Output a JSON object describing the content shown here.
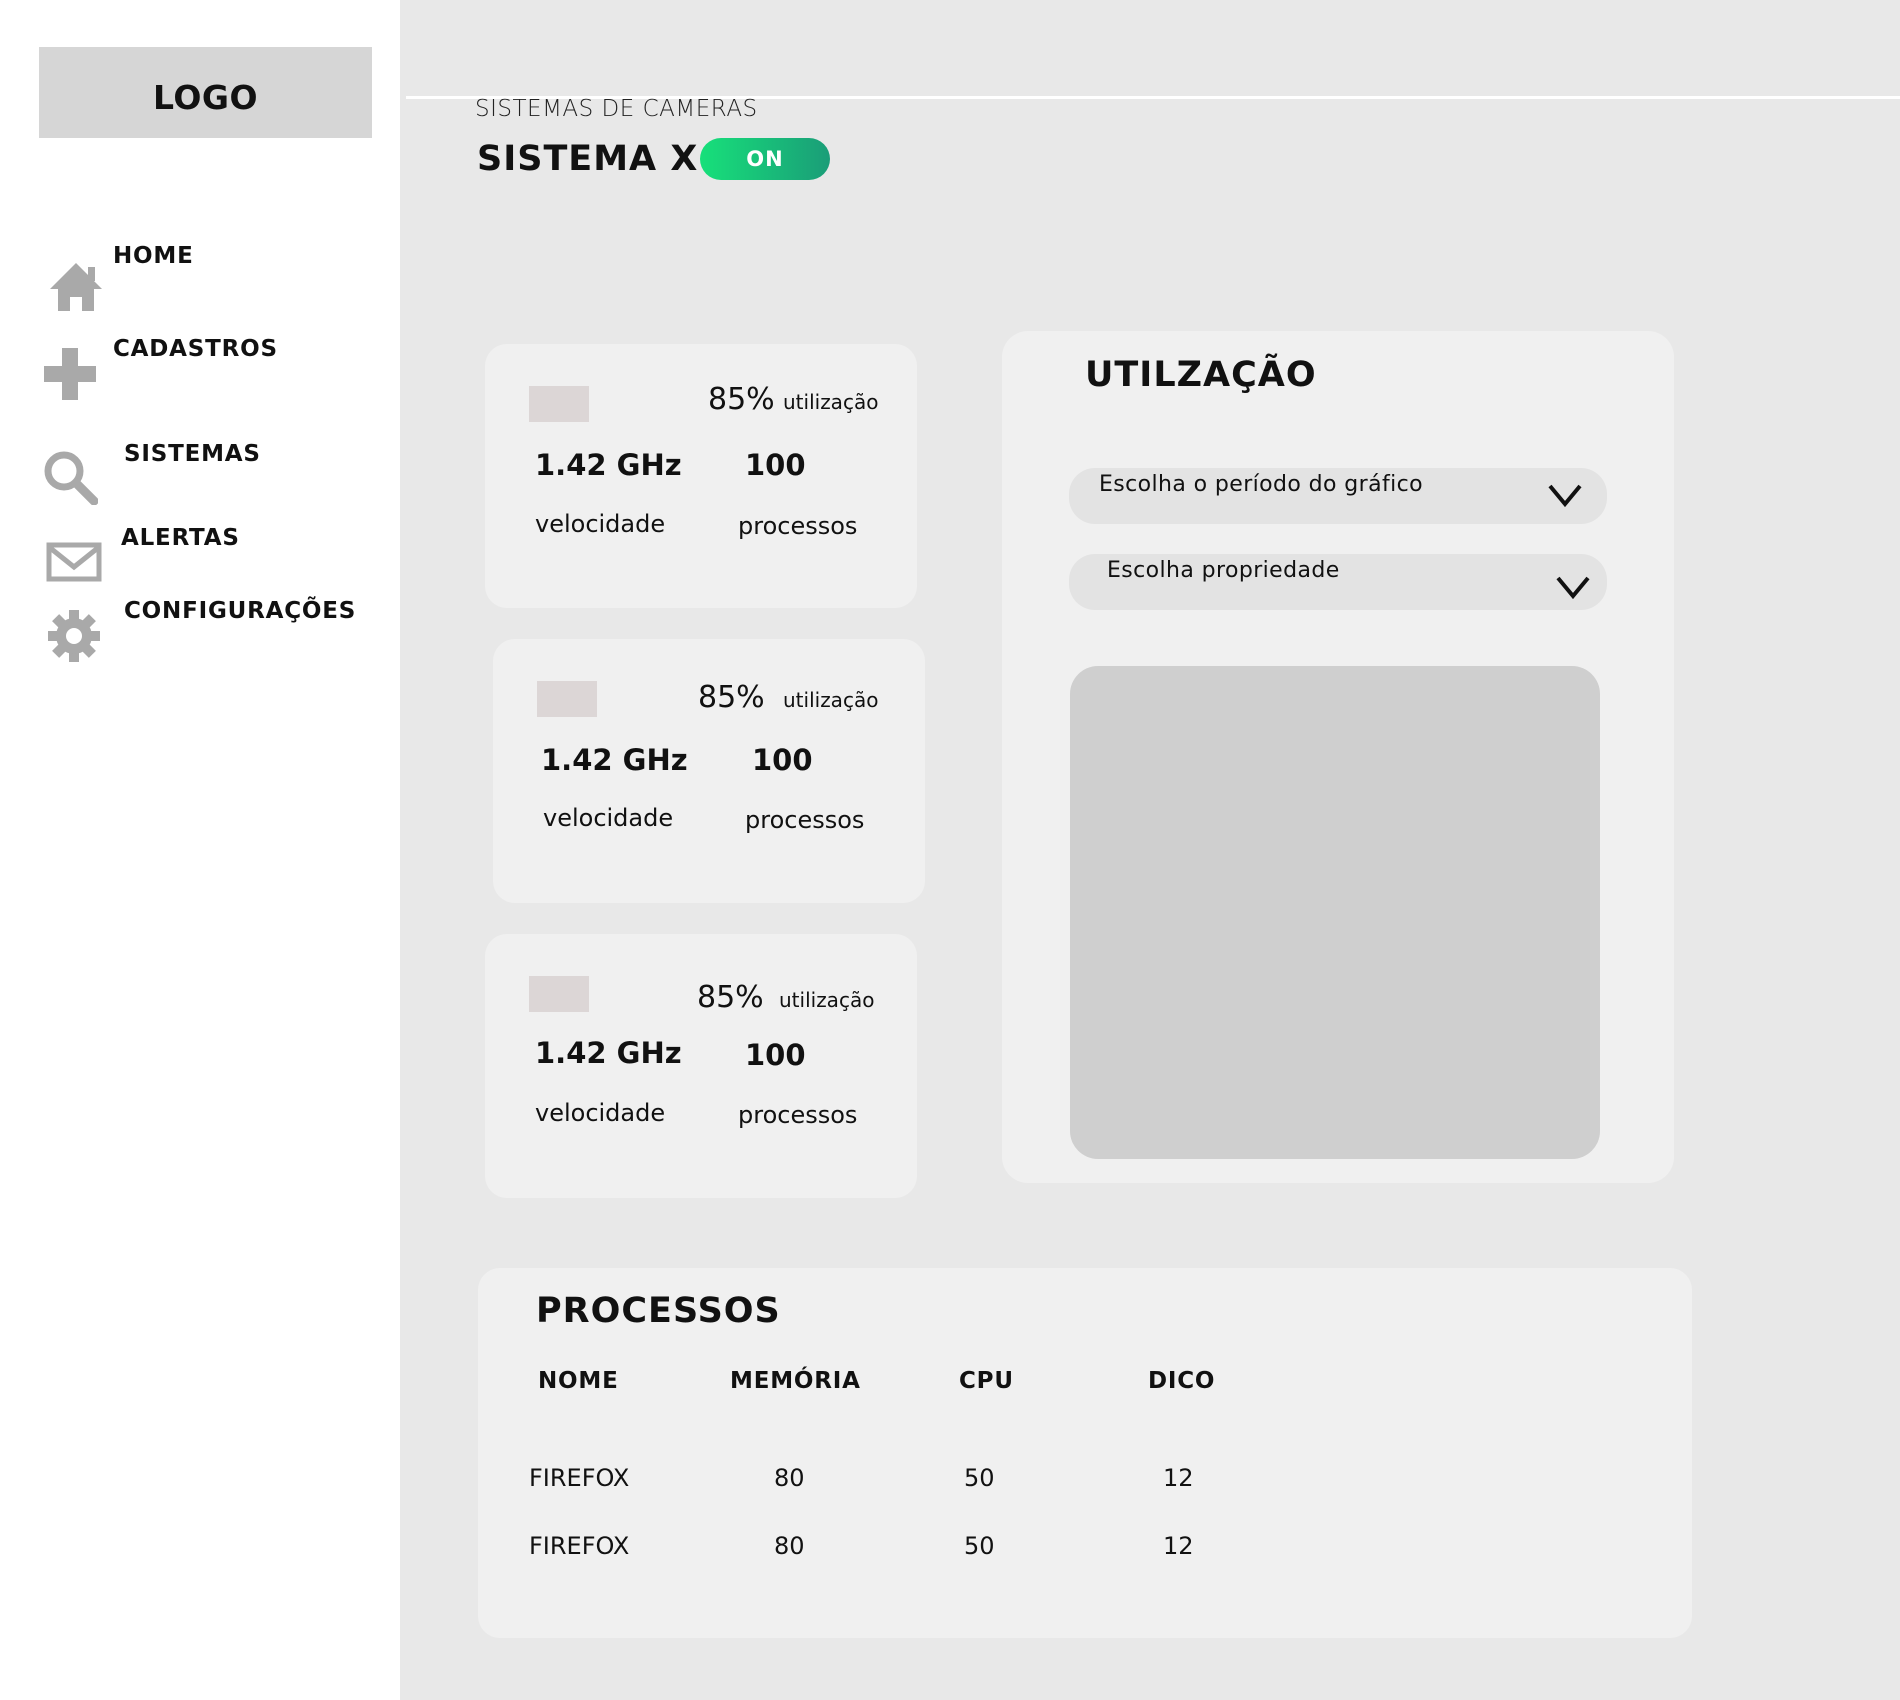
{
  "sidebar": {
    "logo": "LOGO",
    "items": [
      {
        "label": "HOME",
        "icon": "home-icon"
      },
      {
        "label": "CADASTROS",
        "icon": "plus-icon"
      },
      {
        "label": "SISTEMAS",
        "icon": "search-icon"
      },
      {
        "label": "ALERTAS",
        "icon": "mail-icon"
      },
      {
        "label": "CONFIGURAÇÕES",
        "icon": "gear-icon"
      }
    ]
  },
  "header": {
    "breadcrumb": "SISTEMAS DE CAMERAS",
    "title": "SISTEMA X",
    "status_toggle": "ON"
  },
  "cards": [
    {
      "utilization_value": "85%",
      "utilization_label": "utilização",
      "speed_value": "1.42 GHz",
      "speed_label": "velocidade",
      "processes_value": "100",
      "processes_label": "processos"
    },
    {
      "utilization_value": "85%",
      "utilization_label": "utilização",
      "speed_value": "1.42 GHz",
      "speed_label": "velocidade",
      "processes_value": "100",
      "processes_label": "processos"
    },
    {
      "utilization_value": "85%",
      "utilization_label": "utilização",
      "speed_value": "1.42 GHz",
      "speed_label": "velocidade",
      "processes_value": "100",
      "processes_label": "processos"
    }
  ],
  "utilization": {
    "title": "UTILZAÇÃO",
    "period_select": "Escolha o período do gráfico",
    "property_select": "Escolha propriedade"
  },
  "processes": {
    "title": "PROCESSOS",
    "columns": [
      "NOME",
      "MEMÓRIA",
      "CPU",
      "DICO"
    ],
    "rows": [
      [
        "FIREFOX",
        "80",
        "50",
        "12"
      ],
      [
        "FIREFOX",
        "80",
        "50",
        "12"
      ]
    ]
  },
  "colors": {
    "toggle_start": "#17e07a",
    "toggle_end": "#1a9d78",
    "icon_gray": "#a9a9a9"
  }
}
